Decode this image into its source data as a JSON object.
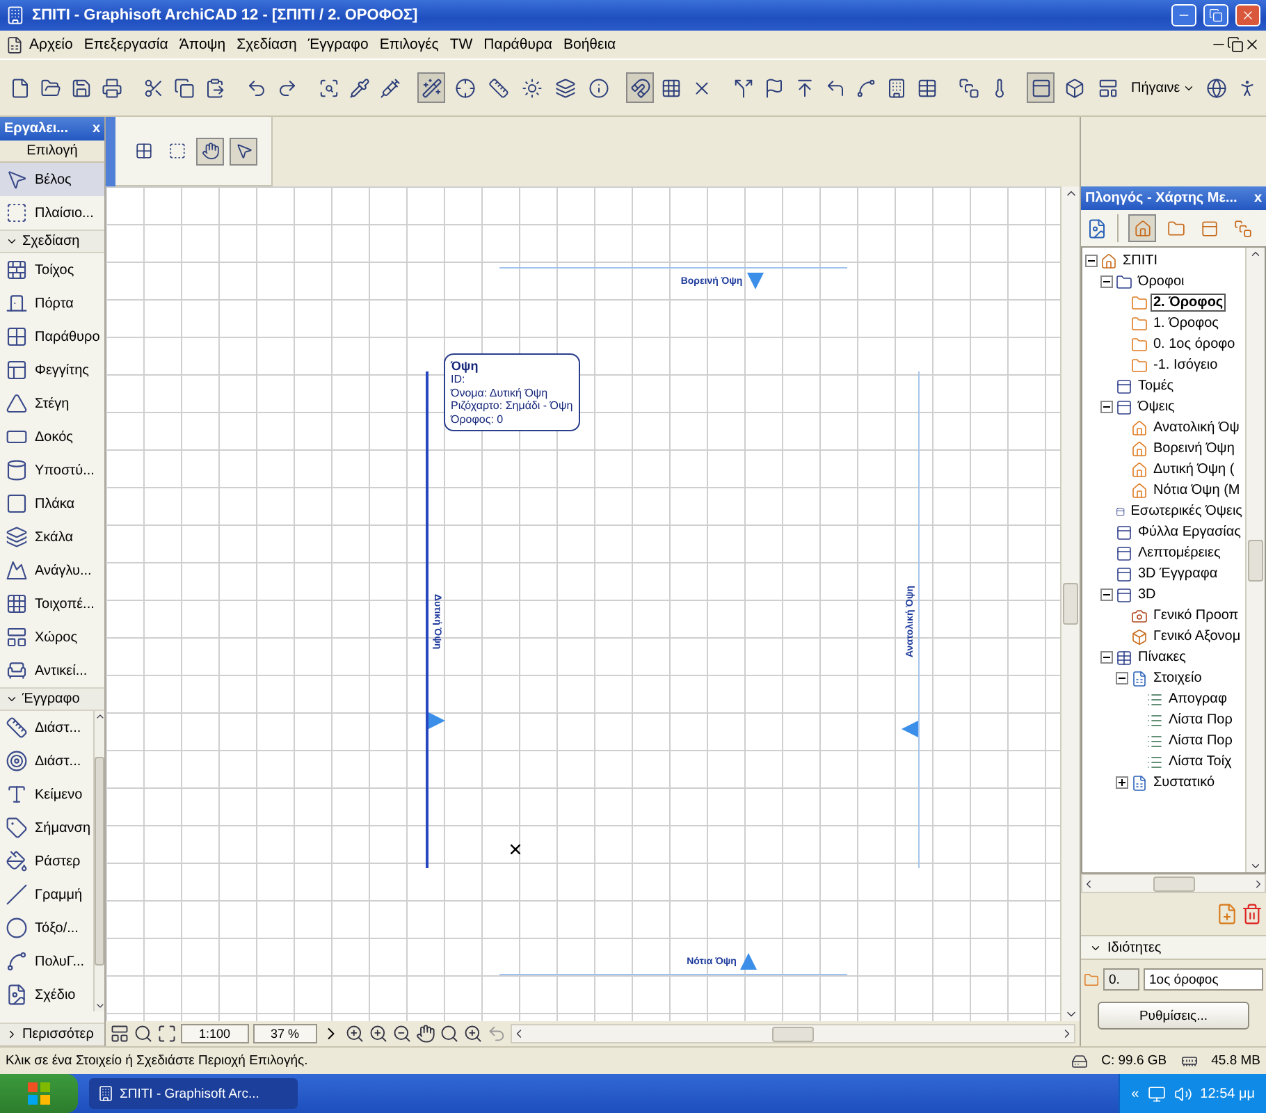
{
  "window": {
    "title": "ΣΠΙΤΙ - Graphisoft ArchiCAD 12 - [ΣΠΙΤΙ / 2. ΟΡΟΦΟΣ]"
  },
  "menu": [
    "Αρχείο",
    "Επεξεργασία",
    "Άποψη",
    "Σχεδίαση",
    "Έγγραφο",
    "Επιλογές",
    "TW",
    "Παράθυρα",
    "Βοήθεια"
  ],
  "toolbar": {
    "buttons": [
      {
        "pressed": false
      },
      {
        "pressed": false
      },
      {
        "pressed": false
      },
      {
        "pressed": false
      },
      {
        "pressed": false
      },
      {
        "pressed": false
      },
      {
        "pressed": false
      },
      {
        "pressed": false
      },
      {
        "pressed": false
      },
      {
        "pressed": false
      },
      {
        "pressed": false
      },
      {
        "pressed": false
      },
      {
        "pressed": true
      },
      {
        "pressed": false
      },
      {
        "pressed": false
      },
      {
        "pressed": false
      },
      {
        "pressed": false
      },
      {
        "pressed": false
      },
      {
        "pressed": true
      },
      {
        "pressed": false
      },
      {
        "pressed": false
      },
      {
        "pressed": false
      },
      {
        "pressed": false
      },
      {
        "pressed": false
      },
      {
        "pressed": false
      },
      {
        "pressed": false
      },
      {
        "pressed": false
      },
      {
        "pressed": false
      },
      {
        "pressed": false
      },
      {
        "pressed": false
      },
      {
        "pressed": true
      },
      {
        "pressed": false
      },
      {
        "pressed": false
      },
      {
        "pressed": false
      },
      {
        "pressed": false
      }
    ],
    "goto": "Πήγαινε"
  },
  "toolbox": {
    "title": "Εργαλει...",
    "close": "x",
    "groups": [
      {
        "label": "Επιλογή",
        "kind": "tab",
        "tools": [
          {
            "label": "Βέλος",
            "selected": true
          },
          {
            "label": "Πλαίσιο...",
            "selected": false
          }
        ]
      },
      {
        "label": "Σχεδίαση",
        "kind": "section",
        "expanded": true,
        "tools": [
          {
            "label": "Τοίχος",
            "selected": false
          },
          {
            "label": "Πόρτα",
            "selected": false
          },
          {
            "label": "Παράθυρο",
            "selected": false
          },
          {
            "label": "Φεγγίτης",
            "selected": false
          },
          {
            "label": "Στέγη",
            "selected": false
          },
          {
            "label": "Δοκός",
            "selected": false
          },
          {
            "label": "Υποστύ...",
            "selected": false
          },
          {
            "label": "Πλάκα",
            "selected": false
          },
          {
            "label": "Σκάλα",
            "selected": false
          },
          {
            "label": "Ανάγλυ...",
            "selected": false
          },
          {
            "label": "Τοιχοπέ...",
            "selected": false
          },
          {
            "label": "Χώρος",
            "selected": false
          },
          {
            "label": "Αντικεί...",
            "selected": false
          }
        ]
      },
      {
        "label": "Έγγραφο",
        "kind": "section",
        "expanded": true,
        "tools": [
          {
            "label": "Διάστ...",
            "selected": false
          },
          {
            "label": "Διάστ...",
            "selected": false
          },
          {
            "label": "Κείμενο",
            "selected": false
          },
          {
            "label": "Σήμανση",
            "selected": false
          },
          {
            "label": "Ράστερ",
            "selected": false
          },
          {
            "label": "Γραμμή",
            "selected": false
          },
          {
            "label": "Τόξο/...",
            "selected": false
          },
          {
            "label": "ΠολυΓ...",
            "selected": false
          },
          {
            "label": "Σχέδιο",
            "selected": false
          }
        ]
      }
    ],
    "more": {
      "label": "Περισσότερ",
      "expanded": false
    }
  },
  "infobox": {
    "tools": [
      {
        "selected": false
      },
      {
        "selected": false
      },
      {
        "selected": true
      },
      {
        "selected": true
      }
    ]
  },
  "canvas": {
    "markers": [
      {
        "kind": "top",
        "label": "Βορεινή Όψη"
      },
      {
        "kind": "left",
        "label": "Δυτική Όψη"
      },
      {
        "kind": "right",
        "label": "Ανατολική Όψη"
      },
      {
        "kind": "bottom",
        "label": "Νότια Όψη"
      }
    ],
    "tooltip": {
      "title": "Όψη",
      "lines": [
        "ID:",
        "Όνομα: Δυτική Όψη",
        "Ριζόχαρτο: Σημάδι - Όψη",
        "Όροφος: 0"
      ]
    }
  },
  "bottom_bar": {
    "scale": "1:100",
    "zoom": "37 %"
  },
  "navigator": {
    "title": "Πλοηγός - Χάρτης Με...",
    "close": "x",
    "views": [
      {
        "selected": true
      },
      {
        "selected": false
      },
      {
        "selected": false
      },
      {
        "selected": false
      }
    ],
    "tree": [
      {
        "label": "ΣΠΙΤΙ",
        "kind": "project",
        "selected": false,
        "expanded": true,
        "children": [
          {
            "label": "Όροφοι",
            "kind": "folder",
            "selected": false,
            "expanded": true,
            "children": [
              {
                "label": "2. Όροφος",
                "kind": "story",
                "selected": true
              },
              {
                "label": "1. Όροφος",
                "kind": "story",
                "selected": false
              },
              {
                "label": "0. 1ος όροφο",
                "kind": "story",
                "selected": false
              },
              {
                "label": "-1. Ισόγειο",
                "kind": "story",
                "selected": false
              }
            ]
          },
          {
            "label": "Τομές",
            "kind": "view",
            "selected": false
          },
          {
            "label": "Όψεις",
            "kind": "view",
            "selected": false,
            "expanded": true,
            "children": [
              {
                "label": "Ανατολική Όψ",
                "kind": "elevation",
                "selected": false
              },
              {
                "label": "Βορεινή Όψη",
                "kind": "elevation",
                "selected": false
              },
              {
                "label": "Δυτική Όψη (",
                "kind": "elevation",
                "selected": false
              },
              {
                "label": "Νότια Όψη (Μ",
                "kind": "elevation",
                "selected": false
              }
            ]
          },
          {
            "label": "Εσωτερικές Όψεις",
            "kind": "view",
            "selected": false
          },
          {
            "label": "Φύλλα Εργασίας",
            "kind": "view",
            "selected": false
          },
          {
            "label": "Λεπτομέρειες",
            "kind": "view",
            "selected": false
          },
          {
            "label": "3D Έγγραφα",
            "kind": "view",
            "selected": false
          },
          {
            "label": "3D",
            "kind": "view",
            "selected": false,
            "expanded": true,
            "children": [
              {
                "label": "Γενικό Προοπ",
                "kind": "camera",
                "selected": false
              },
              {
                "label": "Γενικό Αξονομ",
                "kind": "axon",
                "selected": false
              }
            ]
          },
          {
            "label": "Πίνακες",
            "kind": "table",
            "selected": false,
            "expanded": true,
            "children": [
              {
                "label": "Στοιχείο",
                "kind": "schedule",
                "selected": false,
                "expanded": true,
                "children": [
                  {
                    "label": "Απογραφ",
                    "kind": "list",
                    "selected": false
                  },
                  {
                    "label": "Λίστα Πορ",
                    "kind": "list",
                    "selected": false
                  },
                  {
                    "label": "Λίστα Πορ",
                    "kind": "list",
                    "selected": false
                  },
                  {
                    "label": "Λίστα Τοίχ",
                    "kind": "list",
                    "selected": false
                  }
                ]
              },
              {
                "label": "Συστατικό",
                "kind": "schedule",
                "selected": false,
                "expanded": false
              }
            ]
          }
        ]
      }
    ],
    "properties": {
      "label": "Ιδιότητες",
      "expanded": true,
      "number": "0.",
      "name": "1ος όροφος",
      "button": "Ρυθμίσεις..."
    }
  },
  "status_bar": {
    "message": "Κλικ σε ένα Στοιχείο ή Σχεδιάστε Περιοχή Επιλογής.",
    "disk": "C: 99.6 GB",
    "memory": "45.8 MB"
  },
  "taskbar": {
    "task": "ΣΠΙΤΙ - Graphisoft Arc...",
    "overflow": "«",
    "time": "12:54 μμ"
  }
}
